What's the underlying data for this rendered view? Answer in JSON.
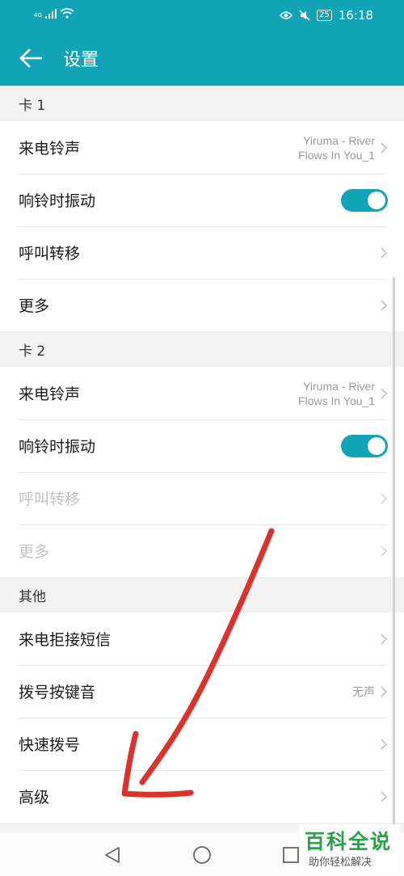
{
  "status_bar": {
    "network": "4G",
    "battery": "25",
    "time": "16:18"
  },
  "app_bar": {
    "title": "设置",
    "back_icon": "arrow-left-icon"
  },
  "sections": [
    {
      "header": "卡 1",
      "rows": [
        {
          "label": "来电铃声",
          "value_line1": "Yiruma - River",
          "value_line2": "Flows In You_1"
        },
        {
          "label": "响铃时振动",
          "toggle": true
        },
        {
          "label": "呼叫转移"
        },
        {
          "label": "更多"
        }
      ]
    },
    {
      "header": "卡 2",
      "rows": [
        {
          "label": "来电铃声",
          "value_line1": "Yiruma - River",
          "value_line2": "Flows In You_1"
        },
        {
          "label": "响铃时振动",
          "toggle": true
        },
        {
          "label": "呼叫转移",
          "disabled": true
        },
        {
          "label": "更多",
          "disabled": true
        }
      ]
    },
    {
      "header": "其他",
      "rows": [
        {
          "label": "来电拒接短信"
        },
        {
          "label": "拨号按键音",
          "value": "无声"
        },
        {
          "label": "快速拨号"
        },
        {
          "label": "高级"
        }
      ]
    }
  ],
  "watermark": {
    "title": "百科全说",
    "subtitle": "助你轻松解决"
  },
  "colors": {
    "accent": "#11a4b7",
    "annotation_arrow": "#d9332b"
  }
}
